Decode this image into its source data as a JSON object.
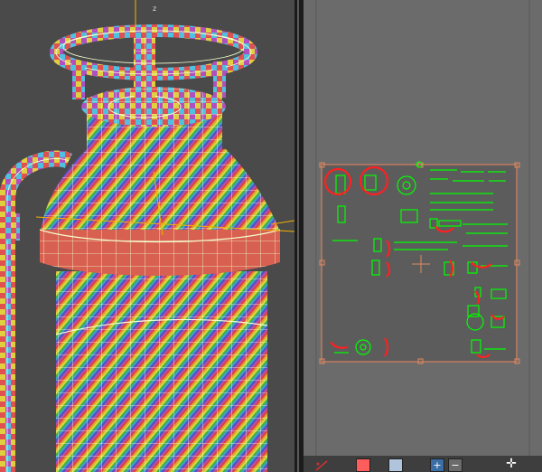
{
  "viewport": {
    "name": "3d-perspective-viewport",
    "gizmo_axis_label": "z",
    "colors": {
      "background": "#4a4a4a",
      "wireframe": "#e9ffb0",
      "selection": "#f2b200"
    }
  },
  "uv_editor": {
    "name": "uv-editor-panel",
    "colors": {
      "background": "#6b6b6b",
      "uv_tile": "#5c5c5c",
      "uv_shells": "#00ff00",
      "markup": "#ff2020",
      "handles": "#e08a60"
    }
  },
  "toolbar": {
    "buttons": [
      {
        "name": "gizmo-icon",
        "color": "#cc3333"
      },
      {
        "name": "color-swatch-button",
        "color": "#ff5c5c"
      },
      {
        "name": "box-icon",
        "color": "#b0c4de"
      },
      {
        "name": "zoom-in-button",
        "color": "#3a6ea5"
      },
      {
        "name": "zoom-out-button",
        "color": "#6b6b6b"
      },
      {
        "name": "pan-icon",
        "color": "#ffffff"
      }
    ]
  }
}
